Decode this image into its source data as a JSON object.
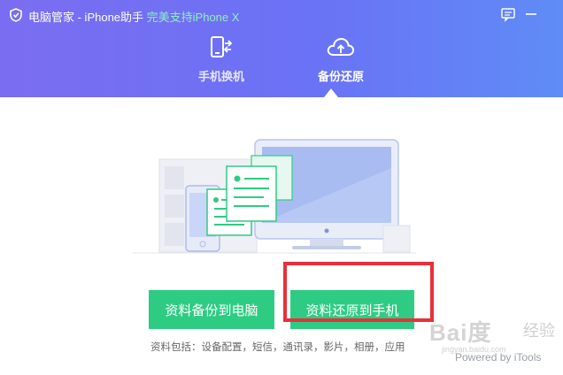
{
  "window": {
    "app_name": "电脑管家 - iPhone助手 ",
    "highlight": "完美支持iPhone X",
    "colors": {
      "header_start": "#7b6df1",
      "header_end": "#5f8cf6",
      "accent_green": "#2ecc83",
      "annotation_red": "#e8303a"
    }
  },
  "titlebar_icons": [
    "shield-logo-icon",
    "feedback-icon",
    "minimize-icon"
  ],
  "tabs": [
    {
      "label": "手机换机",
      "icon": "phone-transfer-icon",
      "active": false
    },
    {
      "label": "备份还原",
      "icon": "cloud-upload-icon",
      "active": true
    }
  ],
  "actions": {
    "backup_label": "资料备份到电脑",
    "restore_label": "资料还原到手机"
  },
  "info_text": "资料包括：设备配置，短信，通讯录，影片，相册，应用",
  "watermark": {
    "logo": "Bai度",
    "jingyan": "经验",
    "url": "jingyan.baidu.com"
  },
  "powered_by": "Powered by iTools"
}
